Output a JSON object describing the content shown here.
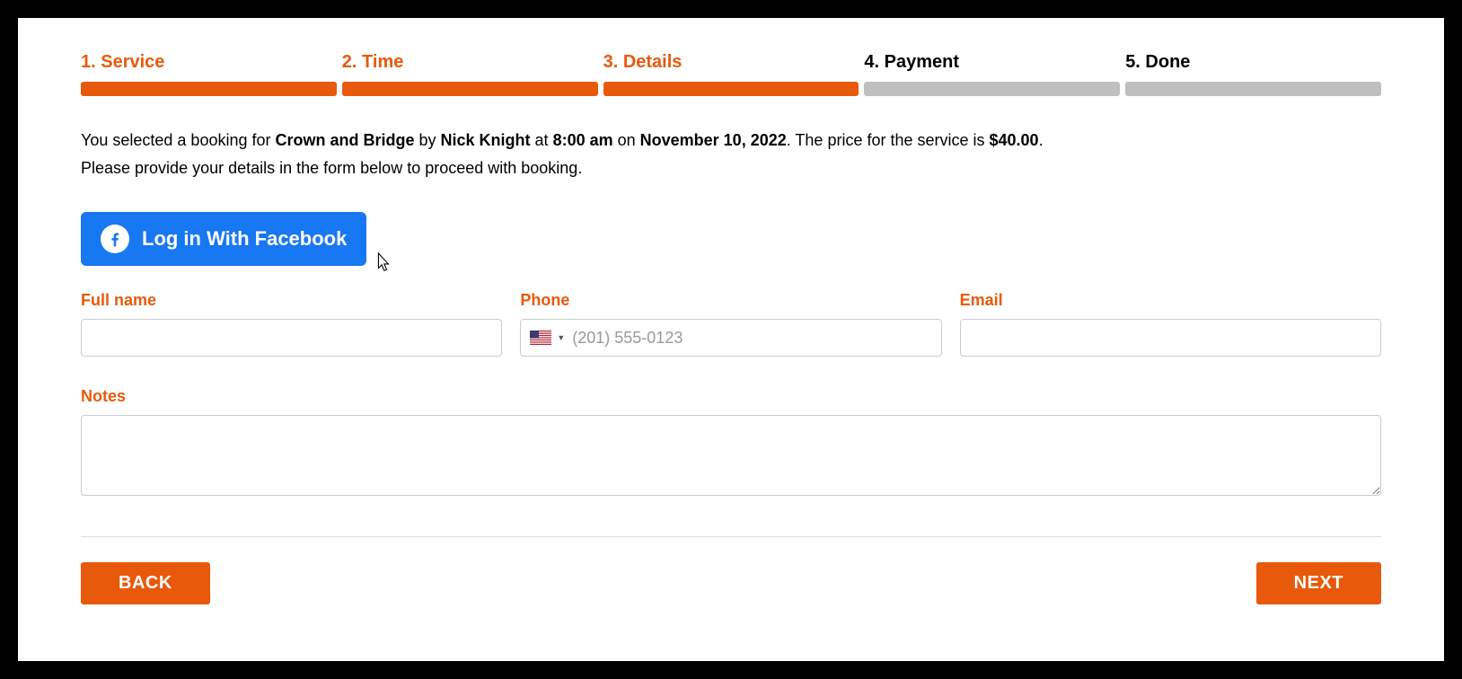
{
  "steps": [
    {
      "label": "1. Service",
      "active": true
    },
    {
      "label": "2. Time",
      "active": true
    },
    {
      "label": "3. Details",
      "active": true
    },
    {
      "label": "4. Payment",
      "active": false
    },
    {
      "label": "5. Done",
      "active": false
    }
  ],
  "summary": {
    "prefix": "You selected a booking for ",
    "service": "Crown and Bridge",
    "by_text": " by ",
    "provider": "Nick Knight",
    "at_text": " at ",
    "time": "8:00 am",
    "on_text": " on ",
    "date": "November 10, 2022",
    "price_prefix": ". The price for the service is ",
    "price": "$40.00",
    "suffix": ".",
    "line2": "Please provide your details in the form below to proceed with booking."
  },
  "facebook_button": "Log in With Facebook",
  "fields": {
    "full_name": {
      "label": "Full name",
      "value": ""
    },
    "phone": {
      "label": "Phone",
      "placeholder": "(201) 555-0123",
      "value": ""
    },
    "email": {
      "label": "Email",
      "value": ""
    },
    "notes": {
      "label": "Notes",
      "value": ""
    }
  },
  "buttons": {
    "back": "BACK",
    "next": "NEXT"
  }
}
